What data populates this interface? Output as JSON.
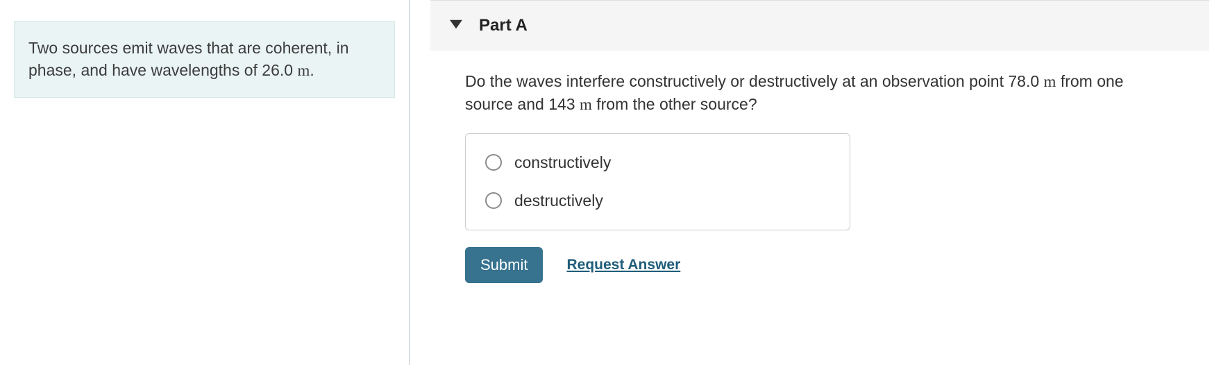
{
  "left": {
    "prompt_prefix": "Two sources emit waves that are coherent, in phase, and have wavelengths of 26.0 ",
    "prompt_unit": "m",
    "prompt_suffix": "."
  },
  "part": {
    "title": "Part A",
    "question_a": "Do the waves interfere constructively or destructively at an observation point 78.0 ",
    "question_unit1": "m",
    "question_b": " from one source and 143 ",
    "question_unit2": "m",
    "question_c": " from the other source?",
    "options": [
      {
        "label": "constructively"
      },
      {
        "label": "destructively"
      }
    ],
    "submit_label": "Submit",
    "request_label": "Request Answer"
  }
}
